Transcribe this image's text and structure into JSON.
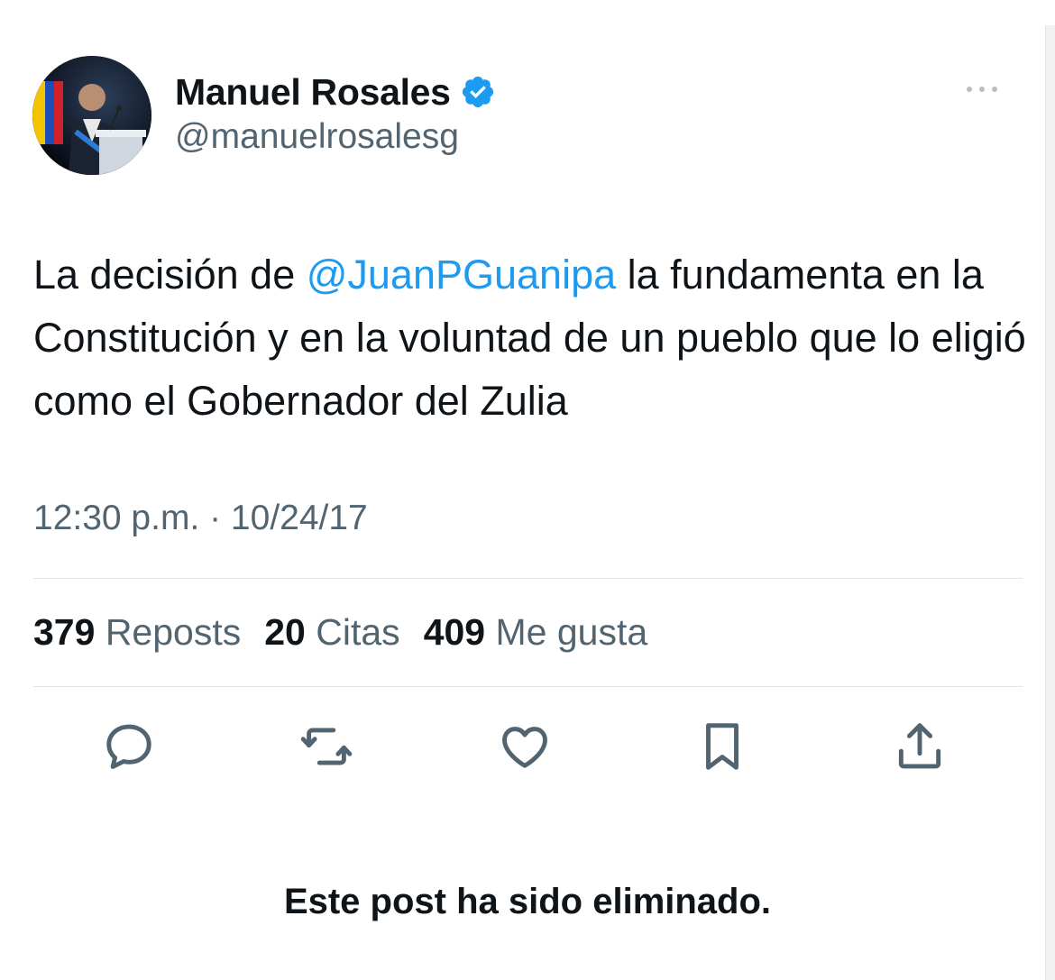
{
  "author": {
    "display_name": "Manuel Rosales",
    "handle": "@manuelrosalesg",
    "verified": true
  },
  "post": {
    "text_before": "La decisión de ",
    "mention": "@JuanPGuanipa",
    "text_after": " la fundamenta en la Constitución y en la voluntad de un pueblo que lo eligió como el Gobernador del Zulia",
    "timestamp": "12:30 p.m. · 10/24/17"
  },
  "stats": {
    "reposts_count": "379",
    "reposts_label": "Reposts",
    "quotes_count": "20",
    "quotes_label": "Citas",
    "likes_count": "409",
    "likes_label": "Me gusta"
  },
  "actions": [
    "reply-icon",
    "repost-icon",
    "like-icon",
    "bookmark-icon",
    "share-icon"
  ],
  "notice": "Este post ha sido eliminado.",
  "colors": {
    "accent": "#1d9bf0",
    "text": "#0f1419",
    "secondary": "#536471",
    "divider": "#dfe4e8"
  }
}
